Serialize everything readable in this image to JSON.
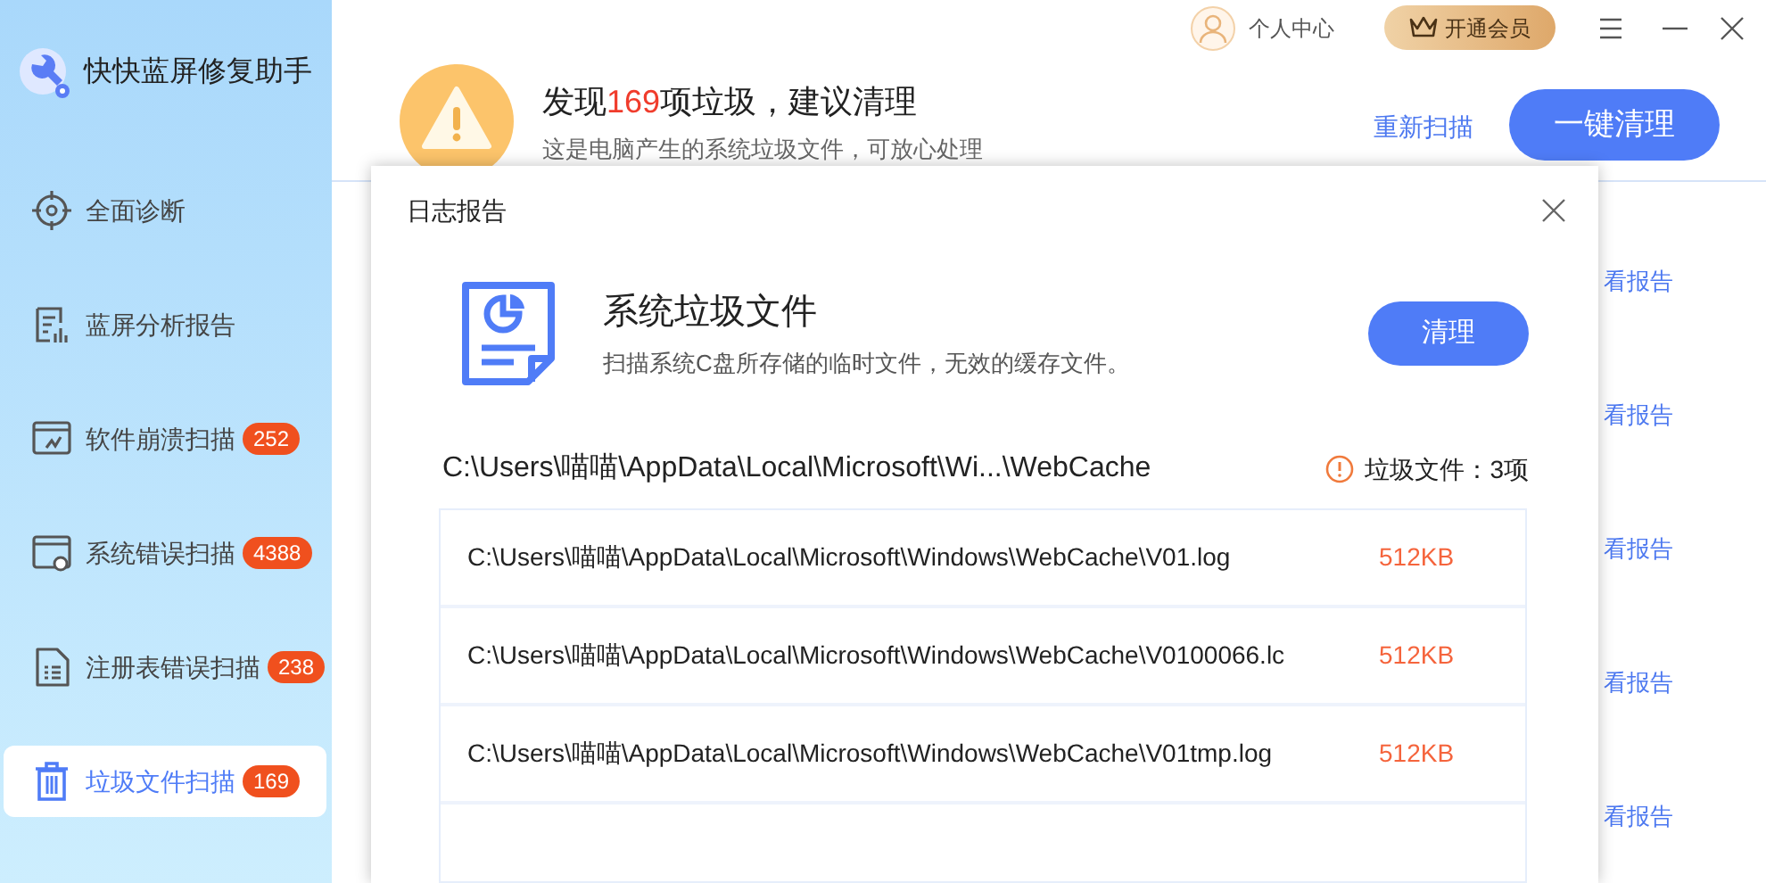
{
  "app": {
    "title": "快快蓝屏修复助手"
  },
  "sidebar": {
    "items": [
      {
        "kind": "diagnose",
        "label": "全面诊断",
        "selected": false
      },
      {
        "kind": "report",
        "label": "蓝屏分析报告",
        "selected": false
      },
      {
        "kind": "crash",
        "label": "软件崩溃扫描",
        "badge": "252",
        "selected": false
      },
      {
        "kind": "system",
        "label": "系统错误扫描",
        "badge": "4388",
        "selected": false
      },
      {
        "kind": "registry",
        "label": "注册表错误扫描",
        "badge": "238",
        "selected": false
      },
      {
        "kind": "trash",
        "label": "垃圾文件扫描",
        "badge": "169",
        "selected": true
      }
    ]
  },
  "top_bar": {
    "user": "个人中心",
    "vip": "开通会员"
  },
  "header": {
    "title_before": "发现",
    "count": "169",
    "title_after": "项垃圾，建议清理",
    "subtitle": "这是电脑产生的系统垃圾文件，可放心处理",
    "rescan": "重新扫描",
    "clean_all": "一键清理"
  },
  "report_links": [
    "看报告",
    "看报告",
    "看报告",
    "看报告",
    "看报告"
  ],
  "dialog": {
    "title": "日志报告",
    "heading": "系统垃圾文件",
    "description": "扫描系统C盘所存储的临时文件，无效的缓存文件。",
    "clean": "清理",
    "folder": "C:\\Users\\喵喵\\AppData\\Local\\Microsoft\\Wi...\\WebCache",
    "count": "垃圾文件：3项",
    "files": [
      {
        "path": "C:\\Users\\喵喵\\AppData\\Local\\Microsoft\\Windows\\WebCache\\V01.log",
        "size": "512KB"
      },
      {
        "path": "C:\\Users\\喵喵\\AppData\\Local\\Microsoft\\Windows\\WebCache\\V0100066.lc",
        "size": "512KB"
      },
      {
        "path": "C:\\Users\\喵喵\\AppData\\Local\\Microsoft\\Windows\\WebCache\\V01tmp.log",
        "size": "512KB"
      }
    ]
  }
}
